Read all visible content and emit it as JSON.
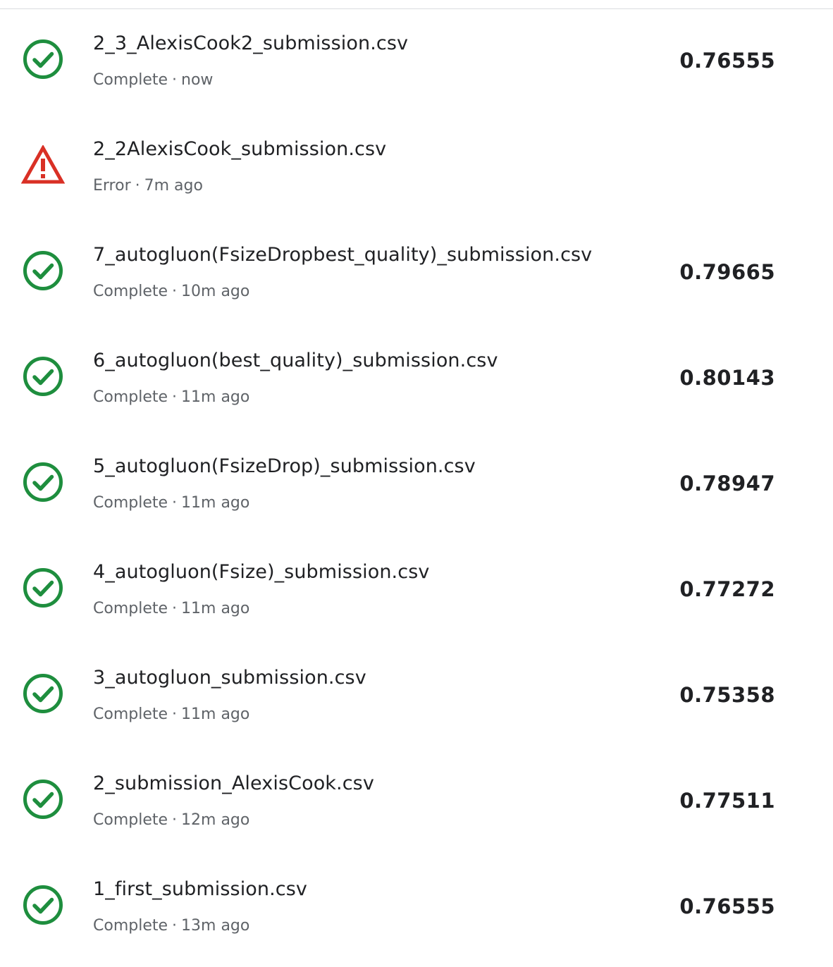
{
  "colors": {
    "success": "#1e8e3e",
    "error": "#d93025",
    "text_primary": "#202124",
    "text_secondary": "#5f6368"
  },
  "submissions": [
    {
      "name": "2_3_AlexisCook2_submission.csv",
      "status": "Complete",
      "status_icon": "check-circle-icon",
      "time": "now",
      "score": "0.76555"
    },
    {
      "name": "2_2AlexisCook_submission.csv",
      "status": "Error",
      "status_icon": "warning-triangle-icon",
      "time": "7m ago",
      "score": ""
    },
    {
      "name": "7_autogluon(FsizeDropbest_quality)_submission.csv",
      "status": "Complete",
      "status_icon": "check-circle-icon",
      "time": "10m ago",
      "score": "0.79665"
    },
    {
      "name": "6_autogluon(best_quality)_submission.csv",
      "status": "Complete",
      "status_icon": "check-circle-icon",
      "time": "11m ago",
      "score": "0.80143"
    },
    {
      "name": "5_autogluon(FsizeDrop)_submission.csv",
      "status": "Complete",
      "status_icon": "check-circle-icon",
      "time": "11m ago",
      "score": "0.78947"
    },
    {
      "name": "4_autogluon(Fsize)_submission.csv",
      "status": "Complete",
      "status_icon": "check-circle-icon",
      "time": "11m ago",
      "score": "0.77272"
    },
    {
      "name": "3_autogluon_submission.csv",
      "status": "Complete",
      "status_icon": "check-circle-icon",
      "time": "11m ago",
      "score": "0.75358"
    },
    {
      "name": "2_submission_AlexisCook.csv",
      "status": "Complete",
      "status_icon": "check-circle-icon",
      "time": "12m ago",
      "score": "0.77511"
    },
    {
      "name": "1_first_submission.csv",
      "status": "Complete",
      "status_icon": "check-circle-icon",
      "time": "13m ago",
      "score": "0.76555"
    }
  ]
}
